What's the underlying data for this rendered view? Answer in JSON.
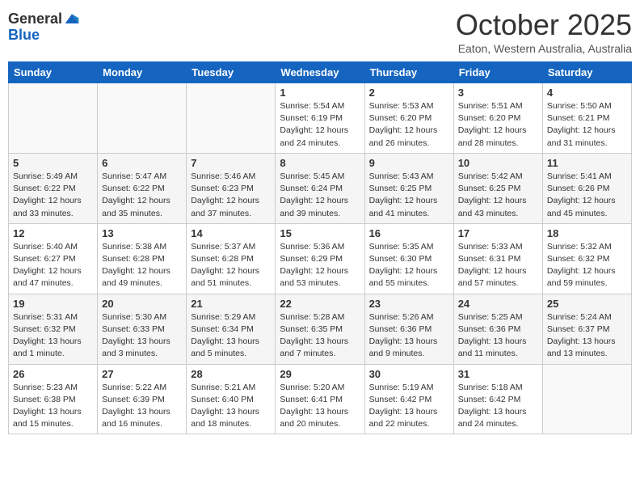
{
  "header": {
    "logo_line1": "General",
    "logo_line2": "Blue",
    "month": "October 2025",
    "location": "Eaton, Western Australia, Australia"
  },
  "days_of_week": [
    "Sunday",
    "Monday",
    "Tuesday",
    "Wednesday",
    "Thursday",
    "Friday",
    "Saturday"
  ],
  "weeks": [
    [
      {
        "day": "",
        "info": ""
      },
      {
        "day": "",
        "info": ""
      },
      {
        "day": "",
        "info": ""
      },
      {
        "day": "1",
        "info": "Sunrise: 5:54 AM\nSunset: 6:19 PM\nDaylight: 12 hours\nand 24 minutes."
      },
      {
        "day": "2",
        "info": "Sunrise: 5:53 AM\nSunset: 6:20 PM\nDaylight: 12 hours\nand 26 minutes."
      },
      {
        "day": "3",
        "info": "Sunrise: 5:51 AM\nSunset: 6:20 PM\nDaylight: 12 hours\nand 28 minutes."
      },
      {
        "day": "4",
        "info": "Sunrise: 5:50 AM\nSunset: 6:21 PM\nDaylight: 12 hours\nand 31 minutes."
      }
    ],
    [
      {
        "day": "5",
        "info": "Sunrise: 5:49 AM\nSunset: 6:22 PM\nDaylight: 12 hours\nand 33 minutes."
      },
      {
        "day": "6",
        "info": "Sunrise: 5:47 AM\nSunset: 6:22 PM\nDaylight: 12 hours\nand 35 minutes."
      },
      {
        "day": "7",
        "info": "Sunrise: 5:46 AM\nSunset: 6:23 PM\nDaylight: 12 hours\nand 37 minutes."
      },
      {
        "day": "8",
        "info": "Sunrise: 5:45 AM\nSunset: 6:24 PM\nDaylight: 12 hours\nand 39 minutes."
      },
      {
        "day": "9",
        "info": "Sunrise: 5:43 AM\nSunset: 6:25 PM\nDaylight: 12 hours\nand 41 minutes."
      },
      {
        "day": "10",
        "info": "Sunrise: 5:42 AM\nSunset: 6:25 PM\nDaylight: 12 hours\nand 43 minutes."
      },
      {
        "day": "11",
        "info": "Sunrise: 5:41 AM\nSunset: 6:26 PM\nDaylight: 12 hours\nand 45 minutes."
      }
    ],
    [
      {
        "day": "12",
        "info": "Sunrise: 5:40 AM\nSunset: 6:27 PM\nDaylight: 12 hours\nand 47 minutes."
      },
      {
        "day": "13",
        "info": "Sunrise: 5:38 AM\nSunset: 6:28 PM\nDaylight: 12 hours\nand 49 minutes."
      },
      {
        "day": "14",
        "info": "Sunrise: 5:37 AM\nSunset: 6:28 PM\nDaylight: 12 hours\nand 51 minutes."
      },
      {
        "day": "15",
        "info": "Sunrise: 5:36 AM\nSunset: 6:29 PM\nDaylight: 12 hours\nand 53 minutes."
      },
      {
        "day": "16",
        "info": "Sunrise: 5:35 AM\nSunset: 6:30 PM\nDaylight: 12 hours\nand 55 minutes."
      },
      {
        "day": "17",
        "info": "Sunrise: 5:33 AM\nSunset: 6:31 PM\nDaylight: 12 hours\nand 57 minutes."
      },
      {
        "day": "18",
        "info": "Sunrise: 5:32 AM\nSunset: 6:32 PM\nDaylight: 12 hours\nand 59 minutes."
      }
    ],
    [
      {
        "day": "19",
        "info": "Sunrise: 5:31 AM\nSunset: 6:32 PM\nDaylight: 13 hours\nand 1 minute."
      },
      {
        "day": "20",
        "info": "Sunrise: 5:30 AM\nSunset: 6:33 PM\nDaylight: 13 hours\nand 3 minutes."
      },
      {
        "day": "21",
        "info": "Sunrise: 5:29 AM\nSunset: 6:34 PM\nDaylight: 13 hours\nand 5 minutes."
      },
      {
        "day": "22",
        "info": "Sunrise: 5:28 AM\nSunset: 6:35 PM\nDaylight: 13 hours\nand 7 minutes."
      },
      {
        "day": "23",
        "info": "Sunrise: 5:26 AM\nSunset: 6:36 PM\nDaylight: 13 hours\nand 9 minutes."
      },
      {
        "day": "24",
        "info": "Sunrise: 5:25 AM\nSunset: 6:36 PM\nDaylight: 13 hours\nand 11 minutes."
      },
      {
        "day": "25",
        "info": "Sunrise: 5:24 AM\nSunset: 6:37 PM\nDaylight: 13 hours\nand 13 minutes."
      }
    ],
    [
      {
        "day": "26",
        "info": "Sunrise: 5:23 AM\nSunset: 6:38 PM\nDaylight: 13 hours\nand 15 minutes."
      },
      {
        "day": "27",
        "info": "Sunrise: 5:22 AM\nSunset: 6:39 PM\nDaylight: 13 hours\nand 16 minutes."
      },
      {
        "day": "28",
        "info": "Sunrise: 5:21 AM\nSunset: 6:40 PM\nDaylight: 13 hours\nand 18 minutes."
      },
      {
        "day": "29",
        "info": "Sunrise: 5:20 AM\nSunset: 6:41 PM\nDaylight: 13 hours\nand 20 minutes."
      },
      {
        "day": "30",
        "info": "Sunrise: 5:19 AM\nSunset: 6:42 PM\nDaylight: 13 hours\nand 22 minutes."
      },
      {
        "day": "31",
        "info": "Sunrise: 5:18 AM\nSunset: 6:42 PM\nDaylight: 13 hours\nand 24 minutes."
      },
      {
        "day": "",
        "info": ""
      }
    ]
  ]
}
